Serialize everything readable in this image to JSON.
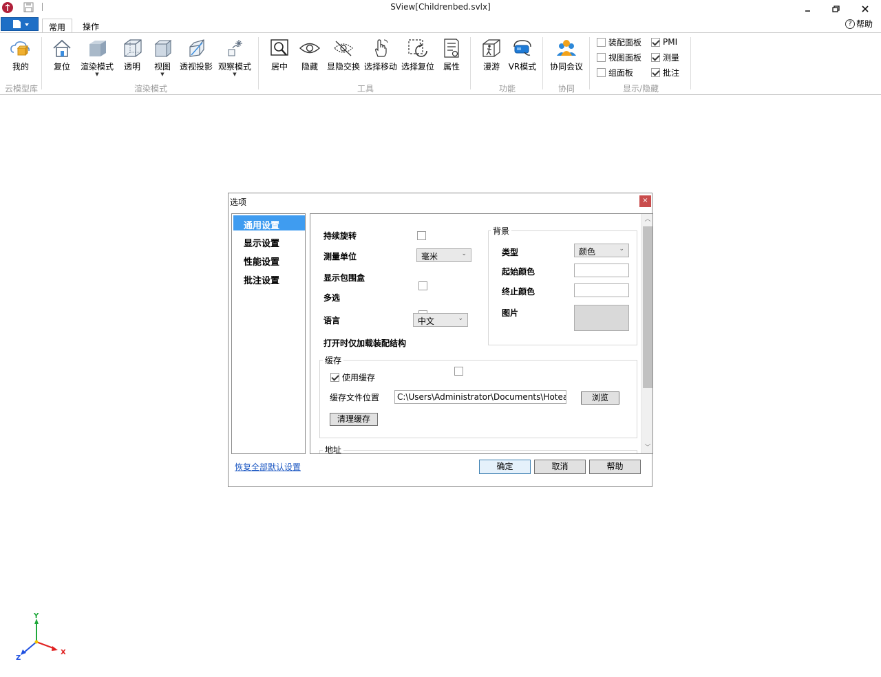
{
  "window": {
    "title": "SView[Childrenbed.svlx]"
  },
  "tabs": [
    {
      "label": "常用"
    },
    {
      "label": "操作"
    }
  ],
  "help": {
    "label": "帮助"
  },
  "ribbon": {
    "buttons": [
      {
        "label": "我的",
        "icon": "cloud-cube-icon"
      },
      {
        "label": "复位",
        "icon": "home-icon"
      },
      {
        "label": "渲染模式",
        "icon": "shaded-cube-icon"
      },
      {
        "label": "透明",
        "icon": "transparent-cube-icon"
      },
      {
        "label": "视图",
        "icon": "view-cube-icon"
      },
      {
        "label": "透视投影",
        "icon": "perspective-icon"
      },
      {
        "label": "观察模式",
        "icon": "observe-mode-icon"
      },
      {
        "label": "居中",
        "icon": "zoom-center-icon"
      },
      {
        "label": "隐藏",
        "icon": "eye-icon"
      },
      {
        "label": "显隐交换",
        "icon": "eye-swap-icon"
      },
      {
        "label": "选择移动",
        "icon": "hand-move-icon"
      },
      {
        "label": "选择复位",
        "icon": "select-reset-icon"
      },
      {
        "label": "属性",
        "icon": "properties-icon"
      },
      {
        "label": "漫游",
        "icon": "walkthrough-icon"
      },
      {
        "label": "VR模式",
        "icon": "vr-headset-icon"
      },
      {
        "label": "协同会议",
        "icon": "meeting-users-icon"
      }
    ],
    "groups": [
      {
        "label": "云模型库"
      },
      {
        "label": "渲染模式"
      },
      {
        "label": "工具"
      },
      {
        "label": "功能"
      },
      {
        "label": "协同"
      },
      {
        "label": "显示/隐藏"
      }
    ],
    "toggles": [
      {
        "label": "装配面板",
        "checked": false
      },
      {
        "label": "视图面板",
        "checked": false
      },
      {
        "label": "组面板",
        "checked": false
      },
      {
        "label": "PMI",
        "checked": true
      },
      {
        "label": "测量",
        "checked": true
      },
      {
        "label": "批注",
        "checked": true
      }
    ]
  },
  "dialog": {
    "title": "选项",
    "close_glyph": "×",
    "nav": [
      {
        "label": "通用设置",
        "active": true
      },
      {
        "label": "显示设置",
        "active": false
      },
      {
        "label": "性能设置",
        "active": false
      },
      {
        "label": "批注设置",
        "active": false
      }
    ],
    "general": {
      "continuous_rotation": {
        "label": "持续旋转",
        "checked": false
      },
      "measure_unit": {
        "label": "测量单位",
        "value": "毫米"
      },
      "show_bbox": {
        "label": "显示包围盒",
        "checked": false
      },
      "multi_select": {
        "label": "多选",
        "checked": false
      },
      "language": {
        "label": "语言",
        "value": "中文"
      },
      "load_assembly_only": {
        "label": "打开时仅加载装配结构",
        "checked": false
      }
    },
    "background": {
      "legend": "背景",
      "type": {
        "label": "类型",
        "value": "颜色"
      },
      "start_color": {
        "label": "起始颜色"
      },
      "end_color": {
        "label": "终止颜色"
      },
      "image": {
        "label": "图片"
      }
    },
    "cache": {
      "legend": "缓存",
      "use_cache": {
        "label": "使用缓存",
        "checked": true
      },
      "location_label": "缓存文件位置",
      "location_value": "C:\\Users\\Administrator\\Documents\\Hotear",
      "browse": "浏览",
      "clear": "清理缓存"
    },
    "address": {
      "legend": "地址"
    },
    "restore_defaults": "恢复全部默认设置",
    "buttons": {
      "ok": "确定",
      "cancel": "取消",
      "help": "帮助"
    }
  },
  "axis": {
    "x": "X",
    "y": "Y",
    "z": "Z"
  },
  "colors": {
    "accent": "#3f9cf0",
    "file_menu": "#1e6fc6",
    "close": "#c94c4c"
  }
}
